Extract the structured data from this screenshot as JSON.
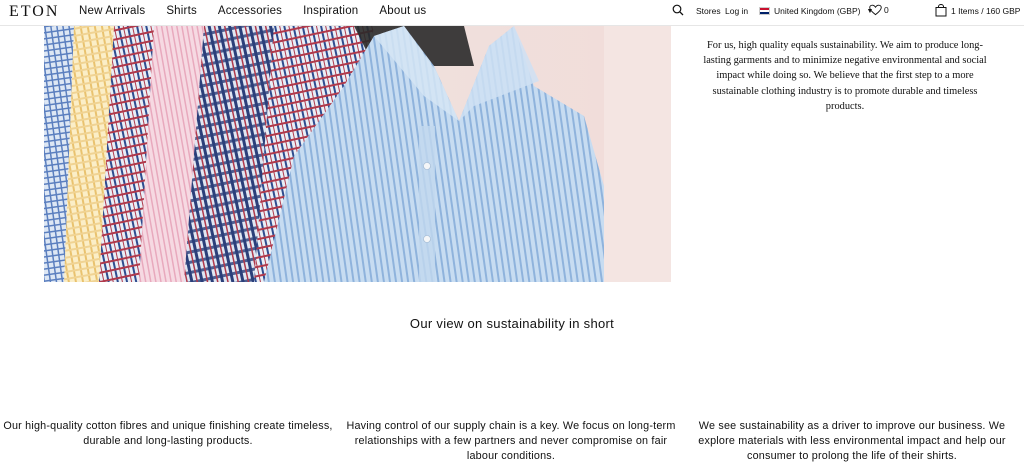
{
  "header": {
    "logo": "ETON",
    "nav": [
      "New Arrivals",
      "Shirts",
      "Accessories",
      "Inspiration",
      "About us"
    ],
    "stores_label": "Stores",
    "login_label": "Log in",
    "country_label": "United Kingdom (GBP)",
    "wishlist_count": "0",
    "cart_label": "1 Items / 160 GBP"
  },
  "intro": {
    "text": "For us, high quality equals sustainability. We aim to produce long-lasting garments and to minimize negative environmental and social impact while doing so. We believe that the first step to a more sustainable clothing industry is to promote durable and timeless products."
  },
  "section": {
    "title": "Our view on sustainability in short"
  },
  "columns": [
    {
      "text": "Our high-quality cotton fibres and unique finishing create timeless, durable and long-lasting products."
    },
    {
      "text": "Having control of our supply chain is a key. We focus on long-term relationships with a few partners and never compromise on fair labour conditions."
    },
    {
      "text": "We see sustainability as a driver to improve our business. We explore materials with less environmental impact and help our consumer to prolong the life of their shirts."
    }
  ],
  "colors": {
    "shirt_blue": "#b9d4ee",
    "shirt_pink": "#f2c9d6",
    "shirt_yellow": "#f5e3a8",
    "check_navy": "#2b3f7a",
    "check_red": "#b0394b"
  }
}
